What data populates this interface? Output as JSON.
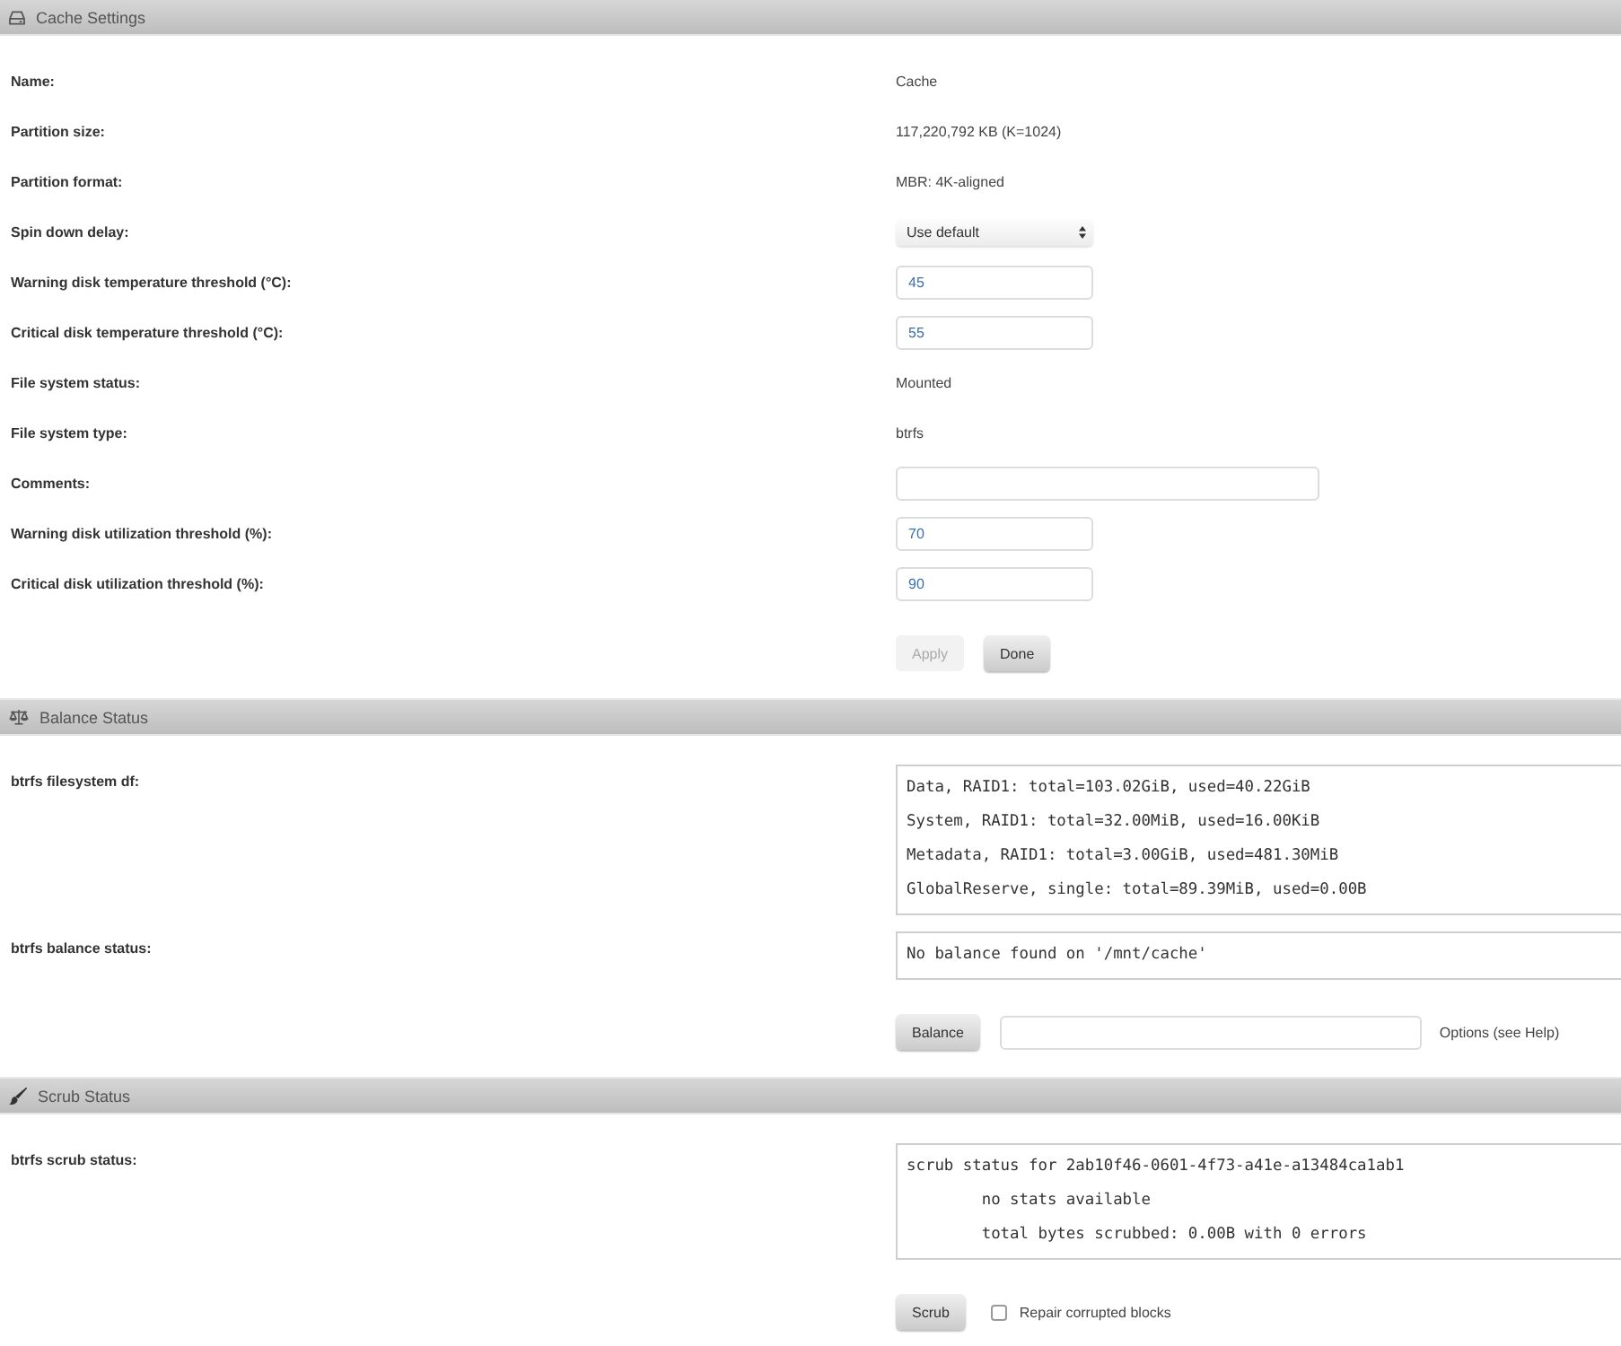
{
  "sections": [
    {
      "kind": "settings",
      "title": "Cache Settings",
      "fields": [
        {
          "kind": "text",
          "label": "Name:",
          "value": "Cache"
        },
        {
          "kind": "text",
          "label": "Partition size:",
          "value": "117,220,792 KB (K=1024)"
        },
        {
          "kind": "text",
          "label": "Partition format:",
          "value": "MBR: 4K-aligned"
        },
        {
          "kind": "select",
          "label": "Spin down delay:",
          "value": "Use default"
        },
        {
          "kind": "number",
          "label": "Warning disk temperature threshold (°C):",
          "value": "45"
        },
        {
          "kind": "number",
          "label": "Critical disk temperature threshold (°C):",
          "value": "55"
        },
        {
          "kind": "text",
          "label": "File system status:",
          "value": "Mounted"
        },
        {
          "kind": "text",
          "label": "File system type:",
          "value": "btrfs"
        },
        {
          "kind": "textfield",
          "label": "Comments:"
        },
        {
          "kind": "number",
          "label": "Warning disk utilization threshold (%):",
          "value": "70"
        },
        {
          "kind": "number",
          "label": "Critical disk utilization threshold (%):",
          "value": "90"
        }
      ],
      "actions": [
        {
          "kind": "button",
          "label": "Apply",
          "disabled": true
        },
        {
          "kind": "button",
          "label": "Done",
          "disabled": false
        }
      ]
    },
    {
      "kind": "balance",
      "title": "Balance Status",
      "fields": [
        {
          "kind": "output",
          "label": "btrfs filesystem df:",
          "lines": [
            "Data, RAID1: total=103.02GiB, used=40.22GiB",
            "System, RAID1: total=32.00MiB, used=16.00KiB",
            "Metadata, RAID1: total=3.00GiB, used=481.30MiB",
            "GlobalReserve, single: total=89.39MiB, used=0.00B"
          ]
        },
        {
          "kind": "output",
          "label": "btrfs balance status:",
          "lines": [
            "No balance found on '/mnt/cache'"
          ]
        }
      ],
      "actions": [
        {
          "kind": "button",
          "label": "Balance",
          "disabled": false
        },
        {
          "kind": "input"
        },
        {
          "kind": "hint",
          "text": "Options (see Help)"
        }
      ]
    },
    {
      "kind": "scrub",
      "title": "Scrub Status",
      "fields": [
        {
          "kind": "output",
          "label": "btrfs scrub status:",
          "lines": [
            "scrub status for 2ab10f46-0601-4f73-a41e-a13484ca1ab1",
            "\tno stats available",
            "\ttotal bytes scrubbed: 0.00B with 0 errors"
          ]
        }
      ],
      "actions": [
        {
          "kind": "button",
          "label": "Scrub",
          "disabled": false
        },
        {
          "kind": "checkbox",
          "label": "Repair corrupted blocks",
          "checked": false
        }
      ]
    }
  ]
}
